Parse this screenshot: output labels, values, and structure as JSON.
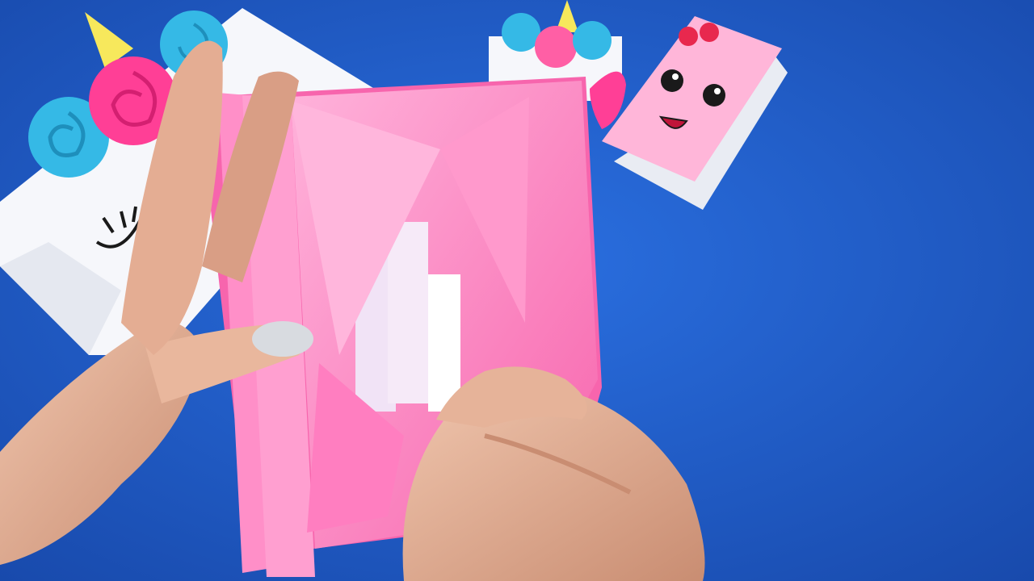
{
  "scene": {
    "colors": {
      "table_blue": "#1f5fd1",
      "table_blue_dark": "#1747a8",
      "paper_pink": "#ff8fc8",
      "paper_pink_light": "#ffb3db",
      "paper_pink_deep": "#f765ad",
      "paper_white": "#f6f7fb",
      "rose_blue": "#35b9e6",
      "rose_pink": "#ff3f96",
      "horn_yellow": "#f7e85c",
      "skin": "#e9b79d",
      "skin_shadow": "#c98d72",
      "nail_silver": "#d8dbe0"
    },
    "objects": [
      "unicorn-paper-envelope-left",
      "unicorn-mini-notebook-top",
      "kawaii-face-mini-notebook",
      "pink-paper-wallet-organizer",
      "left-hand",
      "right-hand"
    ]
  }
}
